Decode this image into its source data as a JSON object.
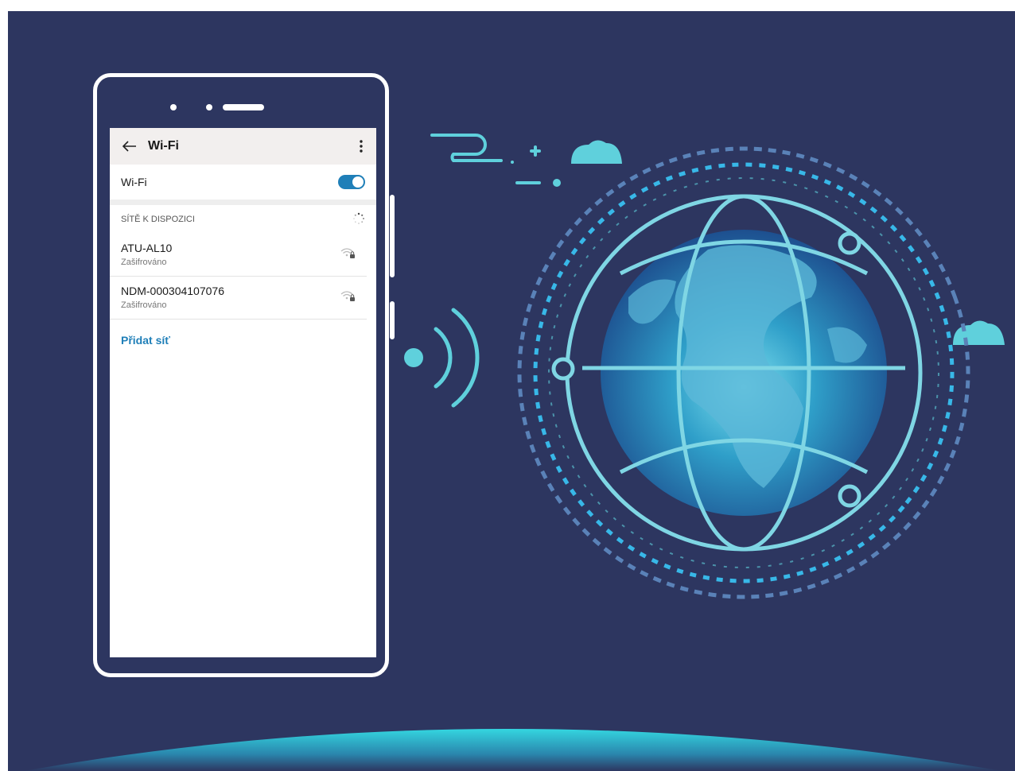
{
  "app": {
    "title": "Wi-Fi"
  },
  "wifi_toggle": {
    "label": "Wi-Fi",
    "state": "on"
  },
  "available_networks": {
    "header": "SÍTĚ K DISPOZICI",
    "networks": [
      {
        "name": "ATU-AL10",
        "status": "Zašifrováno",
        "icon": "wifi-lock-icon"
      },
      {
        "name": "NDM-000304107076",
        "status": "Zašifrováno",
        "icon": "wifi-lock-icon"
      }
    ],
    "add_network_label": "Přidat síť"
  },
  "icons": {
    "back": "arrow-left-icon",
    "more": "more-vertical-icon",
    "scanning": "loading-spinner-icon"
  },
  "colors": {
    "background": "#2d3660",
    "accent": "#1f7fb8",
    "cyan": "#5fd0dc",
    "horizon": "#2ec5d3"
  }
}
